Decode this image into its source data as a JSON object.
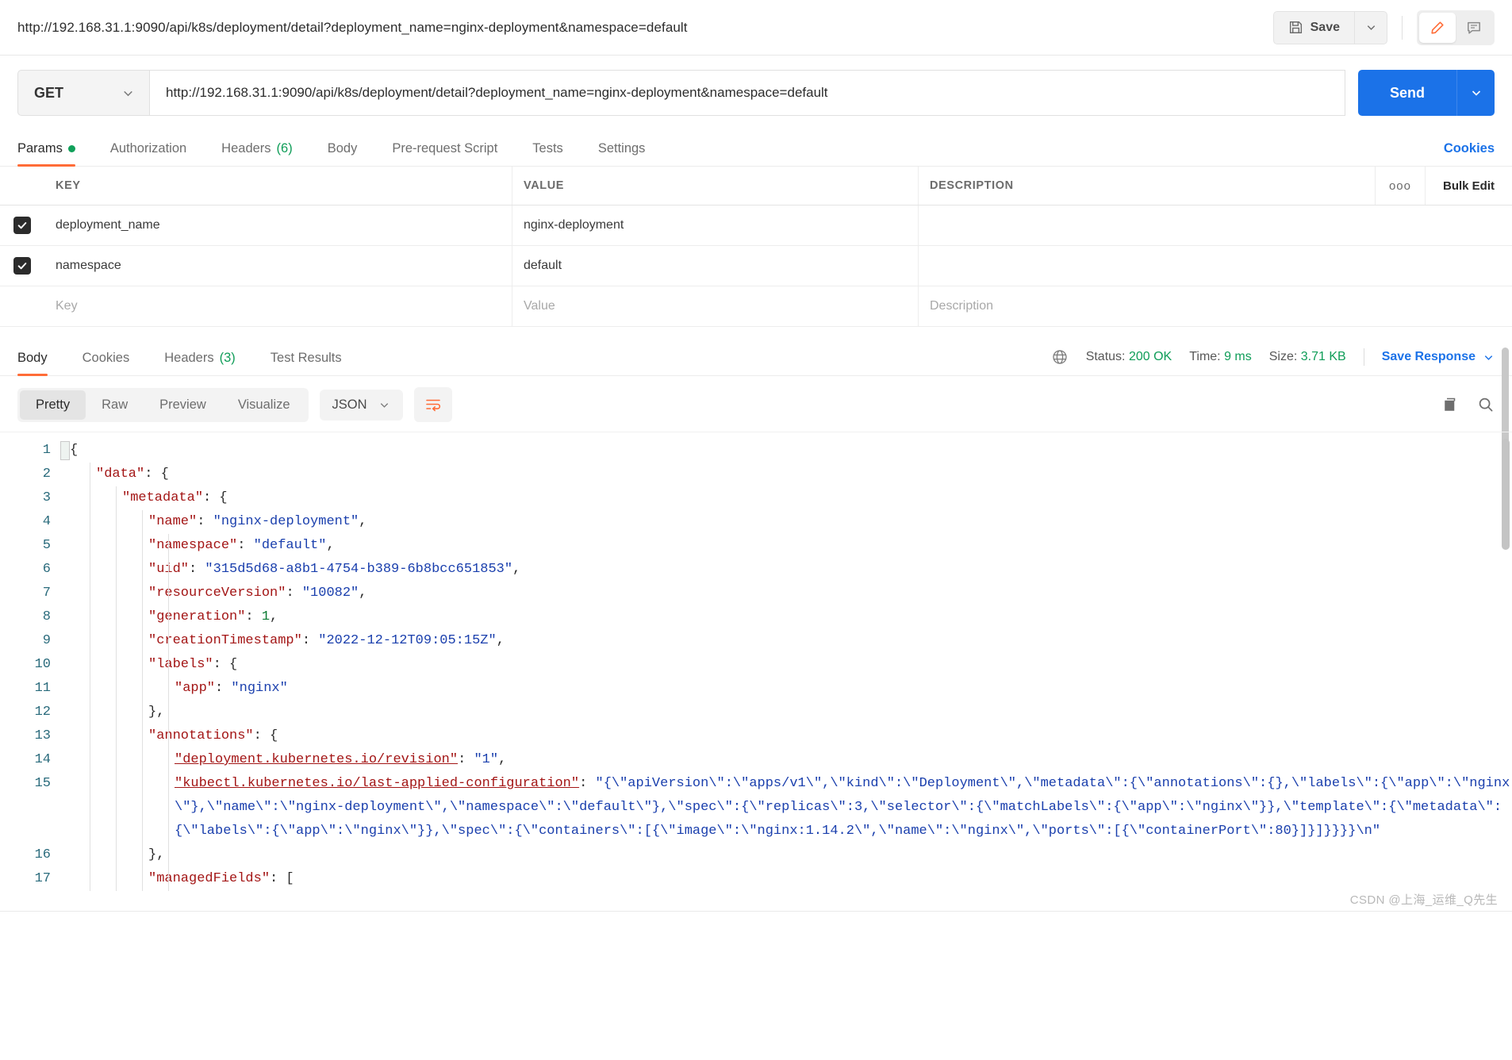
{
  "topbar": {
    "tab_url": "http://192.168.31.1:9090/api/k8s/deployment/detail?deployment_name=nginx-deployment&namespace=default",
    "save_label": "Save",
    "save_icon": "floppy-disk-icon",
    "save_caret_icon": "chevron-down-icon",
    "edit_icon": "pencil-icon",
    "comment_icon": "comment-icon",
    "accent_color": "#ff6c37"
  },
  "request": {
    "method": "GET",
    "method_caret_icon": "chevron-down-icon",
    "url": "http://192.168.31.1:9090/api/k8s/deployment/detail?deployment_name=nginx-deployment&namespace=default",
    "send_label": "Send",
    "send_caret_icon": "chevron-down-icon",
    "send_color": "#1b72e8"
  },
  "request_tabs": [
    {
      "label": "Params",
      "badge": "",
      "dot": true,
      "active": true
    },
    {
      "label": "Authorization",
      "badge": "",
      "dot": false,
      "active": false
    },
    {
      "label": "Headers",
      "badge": "(6)",
      "dot": false,
      "active": false
    },
    {
      "label": "Body",
      "badge": "",
      "dot": false,
      "active": false
    },
    {
      "label": "Pre-request Script",
      "badge": "",
      "dot": false,
      "active": false
    },
    {
      "label": "Tests",
      "badge": "",
      "dot": false,
      "active": false
    },
    {
      "label": "Settings",
      "badge": "",
      "dot": false,
      "active": false
    }
  ],
  "cookies_link": "Cookies",
  "params_table": {
    "headers": {
      "key": "KEY",
      "value": "VALUE",
      "description": "DESCRIPTION"
    },
    "more_icon": "ooo",
    "bulk_edit": "Bulk Edit",
    "rows": [
      {
        "checked": true,
        "key": "deployment_name",
        "value": "nginx-deployment",
        "description": ""
      },
      {
        "checked": true,
        "key": "namespace",
        "value": "default",
        "description": ""
      }
    ],
    "new_row": {
      "key_placeholder": "Key",
      "value_placeholder": "Value",
      "description_placeholder": "Description"
    }
  },
  "response_tabs": [
    {
      "label": "Body",
      "badge": "",
      "active": true
    },
    {
      "label": "Cookies",
      "badge": "",
      "active": false
    },
    {
      "label": "Headers",
      "badge": "(3)",
      "active": false
    },
    {
      "label": "Test Results",
      "badge": "",
      "active": false
    }
  ],
  "response_meta": {
    "globe_icon": "globe-icon",
    "status_label": "Status:",
    "status_value": "200 OK",
    "time_label": "Time:",
    "time_value": "9 ms",
    "size_label": "Size:",
    "size_value": "3.71 KB",
    "save_response": "Save Response",
    "save_response_caret_icon": "chevron-down-icon",
    "ok_color": "#0f9d58"
  },
  "body_toolbar": {
    "views": [
      {
        "label": "Pretty",
        "active": true
      },
      {
        "label": "Raw",
        "active": false
      },
      {
        "label": "Preview",
        "active": false
      },
      {
        "label": "Visualize",
        "active": false
      }
    ],
    "format": "JSON",
    "format_caret_icon": "chevron-down-icon",
    "wrap_icon": "wrap-lines-icon",
    "copy_icon": "copy-icon",
    "search_icon": "search-icon"
  },
  "code": {
    "line_numbers": [
      "1",
      "2",
      "3",
      "4",
      "5",
      "6",
      "7",
      "8",
      "9",
      "10",
      "11",
      "12",
      "13",
      "14",
      "15",
      "16",
      "17"
    ],
    "lines": [
      {
        "n": "1",
        "indent": 0,
        "tokens": [
          {
            "t": "p",
            "v": "{"
          }
        ]
      },
      {
        "n": "2",
        "indent": 1,
        "tokens": [
          {
            "t": "k",
            "v": "\"data\""
          },
          {
            "t": "p",
            "v": ": {"
          }
        ]
      },
      {
        "n": "3",
        "indent": 2,
        "tokens": [
          {
            "t": "k",
            "v": "\"metadata\""
          },
          {
            "t": "p",
            "v": ": {"
          }
        ]
      },
      {
        "n": "4",
        "indent": 3,
        "tokens": [
          {
            "t": "k",
            "v": "\"name\""
          },
          {
            "t": "p",
            "v": ": "
          },
          {
            "t": "s",
            "v": "\"nginx-deployment\""
          },
          {
            "t": "p",
            "v": ","
          }
        ]
      },
      {
        "n": "5",
        "indent": 3,
        "tokens": [
          {
            "t": "k",
            "v": "\"namespace\""
          },
          {
            "t": "p",
            "v": ": "
          },
          {
            "t": "s",
            "v": "\"default\""
          },
          {
            "t": "p",
            "v": ","
          }
        ]
      },
      {
        "n": "6",
        "indent": 3,
        "tokens": [
          {
            "t": "k",
            "v": "\"uid\""
          },
          {
            "t": "p",
            "v": ": "
          },
          {
            "t": "s",
            "v": "\"315d5d68-a8b1-4754-b389-6b8bcc651853\""
          },
          {
            "t": "p",
            "v": ","
          }
        ]
      },
      {
        "n": "7",
        "indent": 3,
        "tokens": [
          {
            "t": "k",
            "v": "\"resourceVersion\""
          },
          {
            "t": "p",
            "v": ": "
          },
          {
            "t": "s",
            "v": "\"10082\""
          },
          {
            "t": "p",
            "v": ","
          }
        ]
      },
      {
        "n": "8",
        "indent": 3,
        "tokens": [
          {
            "t": "k",
            "v": "\"generation\""
          },
          {
            "t": "p",
            "v": ": "
          },
          {
            "t": "n",
            "v": "1"
          },
          {
            "t": "p",
            "v": ","
          }
        ]
      },
      {
        "n": "9",
        "indent": 3,
        "tokens": [
          {
            "t": "k",
            "v": "\"creationTimestamp\""
          },
          {
            "t": "p",
            "v": ": "
          },
          {
            "t": "s",
            "v": "\"2022-12-12T09:05:15Z\""
          },
          {
            "t": "p",
            "v": ","
          }
        ]
      },
      {
        "n": "10",
        "indent": 3,
        "tokens": [
          {
            "t": "k",
            "v": "\"labels\""
          },
          {
            "t": "p",
            "v": ": {"
          }
        ]
      },
      {
        "n": "11",
        "indent": 4,
        "tokens": [
          {
            "t": "k",
            "v": "\"app\""
          },
          {
            "t": "p",
            "v": ": "
          },
          {
            "t": "s",
            "v": "\"nginx\""
          }
        ]
      },
      {
        "n": "12",
        "indent": 3,
        "tokens": [
          {
            "t": "p",
            "v": "},"
          }
        ]
      },
      {
        "n": "13",
        "indent": 3,
        "tokens": [
          {
            "t": "k",
            "v": "\"annotations\""
          },
          {
            "t": "p",
            "v": ": {"
          }
        ]
      },
      {
        "n": "14",
        "indent": 4,
        "tokens": [
          {
            "t": "ku",
            "v": "\"deployment.kubernetes.io/revision\""
          },
          {
            "t": "p",
            "v": ": "
          },
          {
            "t": "s",
            "v": "\"1\""
          },
          {
            "t": "p",
            "v": ","
          }
        ]
      },
      {
        "n": "15",
        "indent": 4,
        "tokens": [
          {
            "t": "ku",
            "v": "\"kubectl.kubernetes.io/last-applied-configuration\""
          },
          {
            "t": "p",
            "v": ": "
          },
          {
            "t": "s",
            "v": "\"{\\\"apiVersion\\\":\\\"apps/v1\\\",\\\"kind\\\":\\\"Deployment\\\",\\\"metadata\\\":{\\\"annotations\\\":{},\\\"labels\\\":{\\\"app\\\":\\\"nginx\\\"},\\\"name\\\":\\\"nginx-deployment\\\",\\\"namespace\\\":\\\"default\\\"},\\\"spec\\\":{\\\"replicas\\\":3,\\\"selector\\\":{\\\"matchLabels\\\":{\\\"app\\\":\\\"nginx\\\"}},\\\"template\\\":{\\\"metadata\\\":{\\\"labels\\\":{\\\"app\\\":\\\"nginx\\\"}},\\\"spec\\\":{\\\"containers\\\":[{\\\"image\\\":\\\"nginx:1.14.2\\\",\\\"name\\\":\\\"nginx\\\",\\\"ports\\\":[{\\\"containerPort\\\":80}]}]}}}}\\n\""
          }
        ]
      },
      {
        "n": "16",
        "indent": 3,
        "tokens": [
          {
            "t": "p",
            "v": "},"
          }
        ]
      },
      {
        "n": "17",
        "indent": 3,
        "tokens": [
          {
            "t": "k",
            "v": "\"managedFields\""
          },
          {
            "t": "p",
            "v": ": ["
          }
        ]
      }
    ]
  },
  "watermark": "CSDN @上海_运维_Q先生"
}
